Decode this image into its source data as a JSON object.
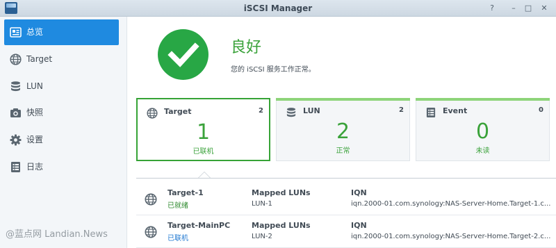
{
  "window": {
    "title": "iSCSI Manager",
    "app_icon_label": "iSCSI"
  },
  "controls": {
    "help": "?",
    "minimize": "–",
    "maximize": "□",
    "close": "✕"
  },
  "sidebar": {
    "items": [
      {
        "label": "总览",
        "icon": "overview-icon",
        "active": true
      },
      {
        "label": "Target",
        "icon": "globe-icon"
      },
      {
        "label": "LUN",
        "icon": "database-icon"
      },
      {
        "label": "快照",
        "icon": "camera-icon"
      },
      {
        "label": "设置",
        "icon": "gear-icon"
      },
      {
        "label": "日志",
        "icon": "log-icon"
      }
    ]
  },
  "status": {
    "title": "良好",
    "description": "您的 iSCSI 服务工作正常。",
    "icon": "check-icon"
  },
  "cards": [
    {
      "title": "Target",
      "count": "2",
      "number": "1",
      "sub": "已联机",
      "icon": "globe-icon",
      "active": true
    },
    {
      "title": "LUN",
      "count": "2",
      "number": "2",
      "sub": "正常",
      "icon": "database-icon"
    },
    {
      "title": "Event",
      "count": "0",
      "number": "0",
      "sub": "未读",
      "icon": "log-icon"
    }
  ],
  "targets": {
    "col_luns": "Mapped LUNs",
    "col_iqn": "IQN",
    "rows": [
      {
        "name": "Target-1",
        "status": "已就绪",
        "lun": "LUN-1",
        "iqn": "iqn.2000-01.com.synology:NAS-Server-Home.Target-1.c..."
      },
      {
        "name": "Target-MainPC",
        "status": "已联机",
        "lun": "LUN-2",
        "iqn": "iqn.2000-01.com.synology:NAS-Server-Home.Target-2.c..."
      }
    ]
  },
  "watermark": "@蓝点网 Landian.News",
  "colors": {
    "accent": "#1f8ae0",
    "success": "#28a745",
    "success_text": "#3aa23a"
  }
}
